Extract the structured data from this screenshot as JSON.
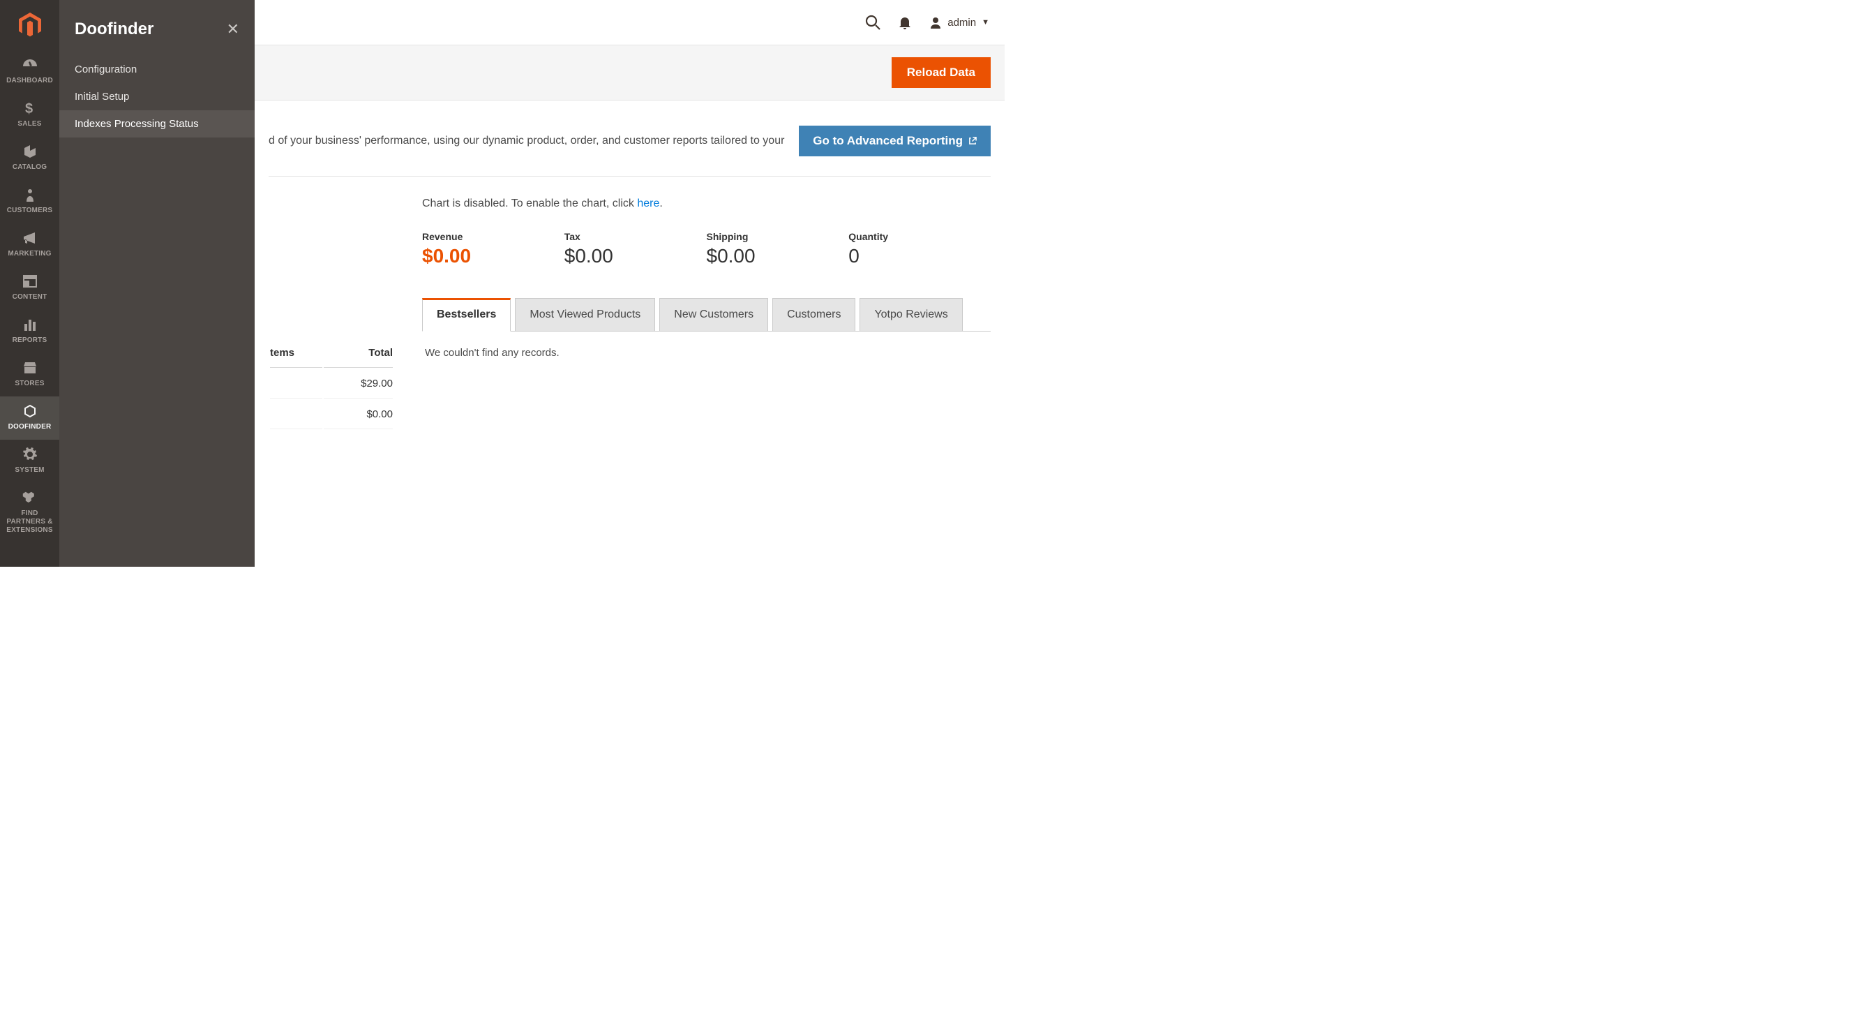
{
  "sidebar": {
    "items": [
      {
        "id": "dashboard",
        "label": "DASHBOARD"
      },
      {
        "id": "sales",
        "label": "SALES"
      },
      {
        "id": "catalog",
        "label": "CATALOG"
      },
      {
        "id": "customers",
        "label": "CUSTOMERS"
      },
      {
        "id": "marketing",
        "label": "MARKETING"
      },
      {
        "id": "content",
        "label": "CONTENT"
      },
      {
        "id": "reports",
        "label": "REPORTS"
      },
      {
        "id": "stores",
        "label": "STORES"
      },
      {
        "id": "doofinder",
        "label": "DOOFINDER"
      },
      {
        "id": "system",
        "label": "SYSTEM"
      },
      {
        "id": "partners",
        "label": "FIND PARTNERS & EXTENSIONS"
      }
    ]
  },
  "flyout": {
    "title": "Doofinder",
    "items": [
      {
        "label": "Configuration"
      },
      {
        "label": "Initial Setup"
      },
      {
        "label": "Indexes Processing Status"
      }
    ]
  },
  "header": {
    "username": "admin"
  },
  "actions": {
    "reload": "Reload Data",
    "advanced": "Go to Advanced Reporting"
  },
  "promo": {
    "text_partial": "d of your business' performance, using our dynamic product, order, and customer reports tailored to your"
  },
  "chart": {
    "msg_prefix": "Chart is disabled. To enable the chart, click ",
    "link": "here",
    "msg_suffix": "."
  },
  "stats": [
    {
      "label": "Revenue",
      "value": "$0.00",
      "accent": true
    },
    {
      "label": "Tax",
      "value": "$0.00"
    },
    {
      "label": "Shipping",
      "value": "$0.00"
    },
    {
      "label": "Quantity",
      "value": "0"
    }
  ],
  "tabs": [
    {
      "label": "Bestsellers",
      "active": true
    },
    {
      "label": "Most Viewed Products"
    },
    {
      "label": "New Customers"
    },
    {
      "label": "Customers"
    },
    {
      "label": "Yotpo Reviews"
    }
  ],
  "tab_empty": "We couldn't find any records.",
  "mini_table": {
    "headers": {
      "items": "tems",
      "total": "Total"
    },
    "rows": [
      {
        "total": "$29.00"
      },
      {
        "total": "$0.00"
      }
    ]
  },
  "colors": {
    "accent": "#eb5202",
    "secondary": "#3f82b5"
  }
}
